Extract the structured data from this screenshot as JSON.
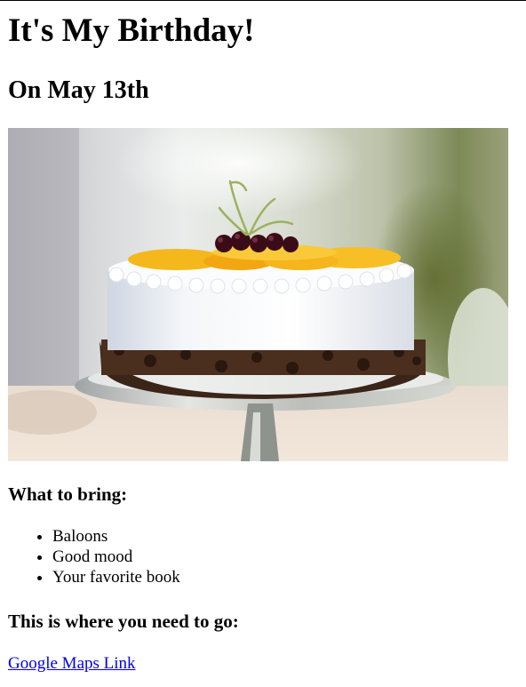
{
  "page": {
    "title": "It's My Birthday!",
    "subtitle": "On May 13th"
  },
  "image": {
    "alt": "Birthday cake",
    "subject": "white frosted cake with mango slices and cherries on a glass cake stand"
  },
  "bring": {
    "heading": "What to bring:",
    "items": [
      {
        "label": "Baloons"
      },
      {
        "label": "Good mood"
      },
      {
        "label": "Your favorite book"
      }
    ]
  },
  "directions": {
    "heading": "This is where you need to go:",
    "link_text": "Google Maps Link"
  },
  "colors": {
    "link": "#0000ee",
    "text": "#000000",
    "background": "#ffffff"
  }
}
